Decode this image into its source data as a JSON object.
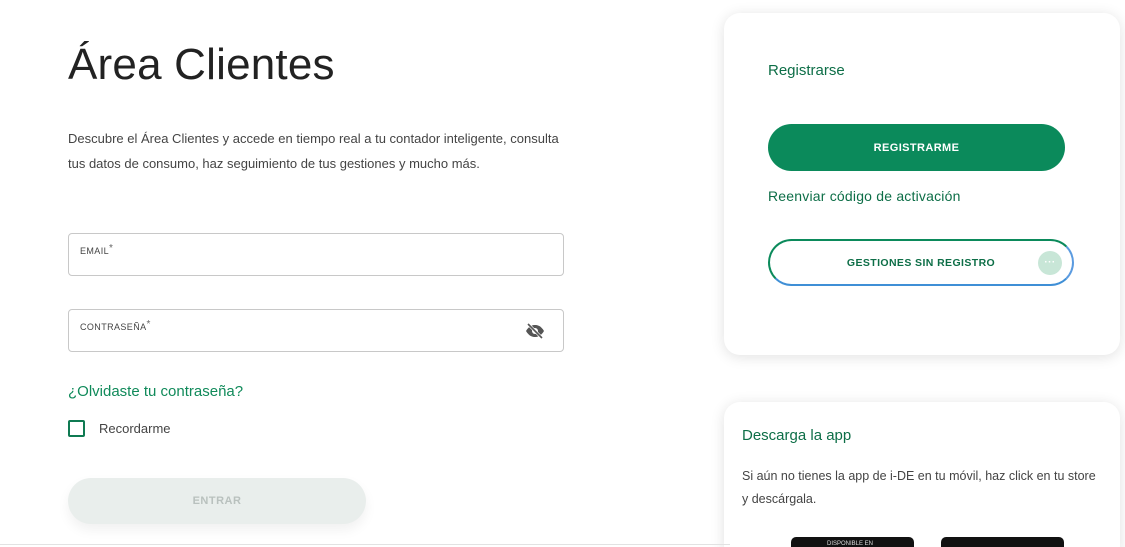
{
  "login": {
    "title": "Área Clientes",
    "intro": "Descubre el Área Clientes y accede en tiempo real a tu contador inteligente, consulta tus datos de consumo, haz seguimiento de tus gestiones y mucho más.",
    "email_label": "EMAIL",
    "password_label": "CONTRASEÑA",
    "required_mark": "*",
    "forgot_link": "¿Olvidaste tu contraseña?",
    "remember_label": "Recordarme",
    "submit_label": "ENTRAR"
  },
  "register": {
    "title": "Registrarse",
    "register_button": "REGISTRARME",
    "resend_link": "Reenviar código de activación",
    "no_register_button": "GESTIONES SIN REGISTRO",
    "more_icon": "···"
  },
  "app": {
    "title": "Descarga la app",
    "description": "Si aún no tienes la app de i-DE en tu móvil, haz click en tu store y descárgala.",
    "google_badge": "DISPONIBLE EN"
  },
  "colors": {
    "brand_green": "#0b8a5b",
    "link_green": "#0d6e47",
    "disabled_button": "#e9eeec"
  }
}
